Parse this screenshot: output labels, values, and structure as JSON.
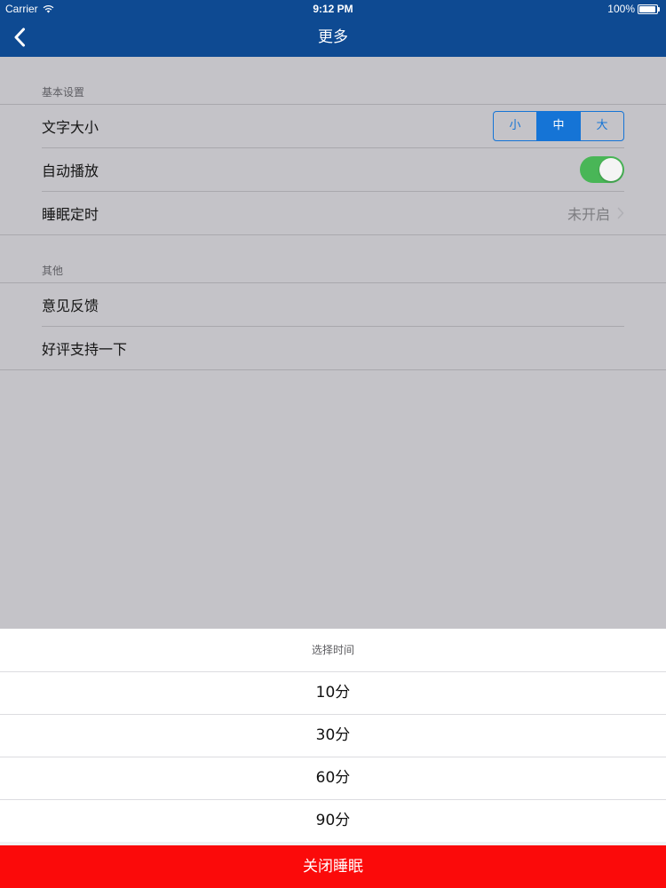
{
  "status_bar": {
    "carrier": "Carrier",
    "time": "9:12 PM",
    "battery": "100%"
  },
  "nav": {
    "title": "更多",
    "back_icon": "chevron-left-icon"
  },
  "colors": {
    "nav_bg": "#0e4a92",
    "accent": "#1574d6",
    "toggle_on": "#49b657",
    "danger": "#fb0a0a",
    "overlay_bg": "#c4c3c8"
  },
  "basic_settings": {
    "header": "基本设置",
    "font_size": {
      "label": "文字大小",
      "options": [
        "小",
        "中",
        "大"
      ],
      "selected": "中"
    },
    "autoplay": {
      "label": "自动播放",
      "on": true
    },
    "sleep_timer": {
      "label": "睡眠定时",
      "value": "未开启"
    }
  },
  "other": {
    "header": "其他",
    "items": [
      {
        "label": "意见反馈"
      },
      {
        "label": "好评支持一下"
      }
    ]
  },
  "sheet": {
    "title": "选择时间",
    "options": [
      "10分",
      "30分",
      "60分",
      "90分"
    ],
    "close_label": "关闭睡眠"
  }
}
